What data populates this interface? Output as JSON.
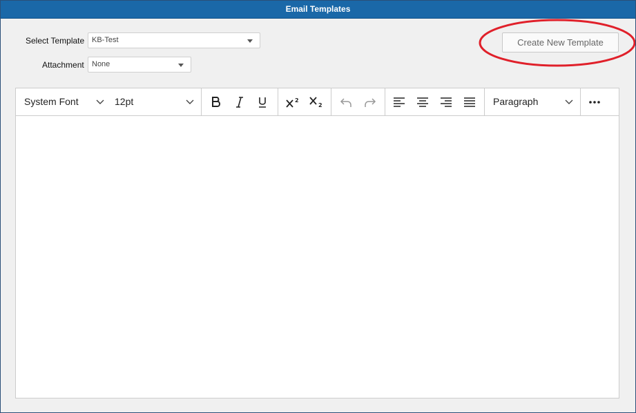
{
  "window": {
    "title": "Email Templates"
  },
  "form": {
    "select_template": {
      "label": "Select Template",
      "value": "KB-Test"
    },
    "attachment": {
      "label": "Attachment",
      "value": "None"
    }
  },
  "create_button": {
    "label": "Create New Template"
  },
  "toolbar": {
    "font_family": "System Font",
    "font_size": "12pt",
    "block_format": "Paragraph",
    "buttons": [
      "bold",
      "italic",
      "underline",
      "superscript",
      "subscript",
      "undo",
      "redo",
      "align-left",
      "align-center",
      "align-right",
      "align-justify",
      "more"
    ]
  },
  "editor": {
    "content": ""
  },
  "colors": {
    "titlebar": "#1a68a8",
    "highlight": "#e0202a",
    "background": "#f0f0f0"
  }
}
